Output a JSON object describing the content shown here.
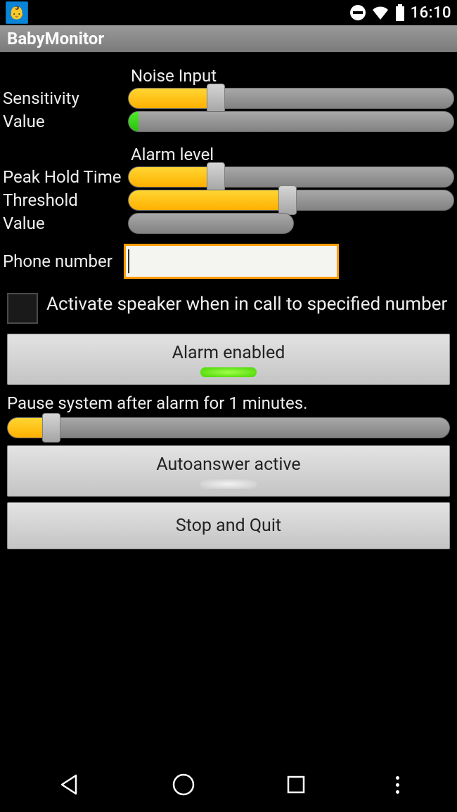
{
  "status": {
    "time": "16:10"
  },
  "title": "BabyMonitor",
  "noise": {
    "heading": "Noise Input",
    "sensitivity_label": "Sensitivity",
    "sensitivity_pct": 27,
    "value_label": "Value",
    "value_pct": 3
  },
  "alarm": {
    "heading": "Alarm level",
    "peak_label": "Peak Hold Time",
    "peak_pct": 27,
    "threshold_label": "Threshold",
    "threshold_pct": 49,
    "value_label": "Value",
    "value_pct": 0
  },
  "phone": {
    "label": "Phone number",
    "value": ""
  },
  "speaker_checkbox": {
    "label": "Activate speaker when in call to specified number",
    "checked": false
  },
  "buttons": {
    "alarm_enabled": "Alarm enabled",
    "autoanswer": "Autoanswer active",
    "stop_quit": "Stop and Quit"
  },
  "pause": {
    "label": "Pause system after alarm for 1 minutes.",
    "pct": 10
  }
}
